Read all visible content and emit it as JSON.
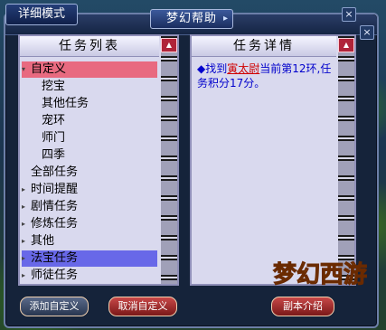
{
  "window": {
    "mode_button": "详细模式",
    "title": "梦幻帮助",
    "title_arrow": "▸"
  },
  "task_list": {
    "header": "任务列表",
    "items": [
      {
        "label": "自定义",
        "twisty": "▾",
        "indent": 0,
        "state": "expanded-selected"
      },
      {
        "label": "挖宝",
        "twisty": "",
        "indent": 1,
        "state": ""
      },
      {
        "label": "其他任务",
        "twisty": "",
        "indent": 1,
        "state": ""
      },
      {
        "label": "宠环",
        "twisty": "",
        "indent": 1,
        "state": ""
      },
      {
        "label": "师门",
        "twisty": "",
        "indent": 1,
        "state": ""
      },
      {
        "label": "四季",
        "twisty": "",
        "indent": 1,
        "state": ""
      },
      {
        "label": "全部任务",
        "twisty": "",
        "indent": 0,
        "state": ""
      },
      {
        "label": "时间提醒",
        "twisty": "▸",
        "indent": 0,
        "state": ""
      },
      {
        "label": "剧情任务",
        "twisty": "▸",
        "indent": 0,
        "state": ""
      },
      {
        "label": "修炼任务",
        "twisty": "▸",
        "indent": 0,
        "state": ""
      },
      {
        "label": "其他",
        "twisty": "▸",
        "indent": 0,
        "state": ""
      },
      {
        "label": "法宝任务",
        "twisty": "▸",
        "indent": 0,
        "state": "hover"
      },
      {
        "label": "师徒任务",
        "twisty": "▸",
        "indent": 0,
        "state": ""
      }
    ]
  },
  "task_detail": {
    "header": "任务详情",
    "bullet": "◆",
    "prefix": "找到",
    "npc_link": "寅太尉",
    "suffix": "当前第12环,任务积分17分。"
  },
  "buttons": {
    "add_custom": "添加自定义",
    "cancel_custom": "取消自定义",
    "instance_intro": "副本介绍"
  },
  "icons": {
    "close": "×",
    "scroll_up": "▲"
  },
  "logo": {
    "text": "梦幻西游"
  }
}
